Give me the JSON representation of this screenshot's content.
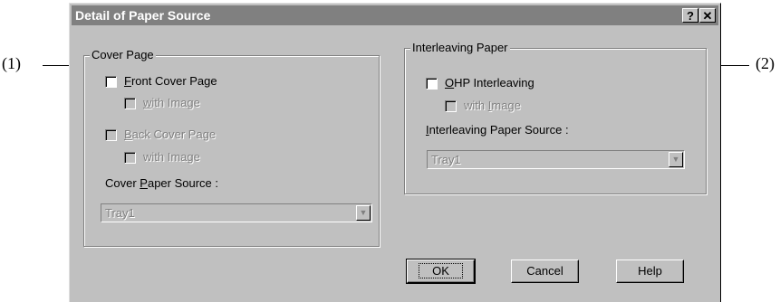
{
  "callouts": {
    "left": "(1)",
    "right": "(2)"
  },
  "dialog": {
    "title": "Detail of Paper Source",
    "help_button": "?",
    "close_button": "✕"
  },
  "cover_page": {
    "legend": "Cover Page",
    "front_cover": {
      "prefix": "",
      "accel": "F",
      "rest": "ront Cover Page",
      "checked": false
    },
    "front_with_image": {
      "prefix": "",
      "accel": "w",
      "rest": "ith Image",
      "checked": false,
      "enabled": false
    },
    "back_cover": {
      "prefix": "",
      "accel": "B",
      "rest": "ack Cover Page",
      "checked": false,
      "enabled": false
    },
    "back_with_image": {
      "text": "with Image",
      "checked": false,
      "enabled": false
    },
    "source_label": {
      "prefix": "Cover ",
      "accel": "P",
      "rest": "aper Source :"
    },
    "source_value": "Tray1"
  },
  "interleaving": {
    "legend": "Interleaving Paper",
    "ohp": {
      "prefix": "",
      "accel": "O",
      "rest": "HP Interleaving",
      "checked": false
    },
    "with_image": {
      "prefix": "with ",
      "accel": "I",
      "rest": "mage",
      "checked": false,
      "enabled": false
    },
    "source_label": {
      "prefix": "",
      "accel": "I",
      "rest": "nterleaving Paper Source :"
    },
    "source_value": "Tray1"
  },
  "buttons": {
    "ok": "OK",
    "cancel": "Cancel",
    "help": "Help"
  }
}
